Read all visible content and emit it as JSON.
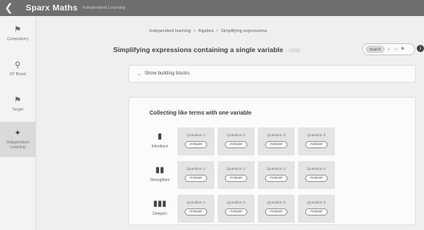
{
  "topbar": {
    "back_icon": "chevron-left-icon",
    "brand": "Sparx Maths",
    "subbrand": "Independent Learning"
  },
  "sidebar": {
    "items": [
      {
        "icon": "trophy-icon",
        "label": "Compulsory",
        "active": false
      },
      {
        "icon": "lightbulb-icon",
        "label": "XP Boost",
        "active": false
      },
      {
        "icon": "trophy-icon",
        "label": "Target",
        "active": false
      },
      {
        "icon": "book-icon",
        "label": "Independent Learning",
        "active": true
      }
    ]
  },
  "breadcrumb": {
    "items": [
      "Independent learning",
      "Algebra",
      "Simplifying expressions"
    ],
    "separator": ">"
  },
  "page": {
    "title": "Simplifying expressions containing a single variable",
    "tag": "- U933"
  },
  "toolbar": {
    "search_label": "Search",
    "icons": [
      "check-icon",
      "star-icon",
      "flag-icon"
    ]
  },
  "building_blocks": {
    "label": "Show building blocks"
  },
  "section": {
    "title": "Collecting like terms with one variable",
    "levels": [
      {
        "name": "Introduce",
        "questions": [
          "Question 1",
          "Question 2",
          "Question 3",
          "Question 4"
        ],
        "answer_label": "Answer"
      },
      {
        "name": "Strengthen",
        "questions": [
          "Question 1",
          "Question 2",
          "Question 3",
          "Question 4"
        ],
        "answer_label": "Answer"
      },
      {
        "name": "Deepen",
        "questions": [
          "Question 1",
          "Question 2",
          "Question 3",
          "Question 4"
        ],
        "answer_label": "Answer"
      }
    ]
  }
}
